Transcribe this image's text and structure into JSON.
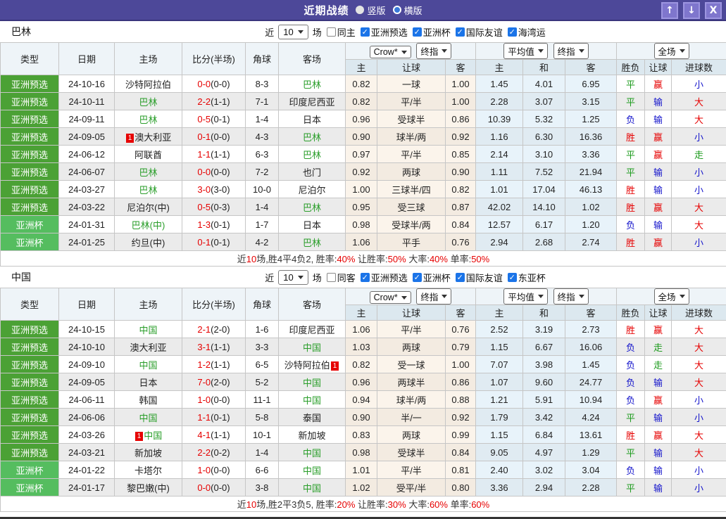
{
  "title_bar": {
    "title": "近期战绩",
    "vertical_label": "竖版",
    "horizontal_label": "横版",
    "up_button": "↑",
    "down_button": "↓",
    "close_button": "X"
  },
  "table_header": {
    "left_cols": [
      "类型",
      "日期",
      "主场",
      "比分(半场)",
      "角球",
      "客场"
    ],
    "dd_company": "Crow*",
    "dd_final1": "终指",
    "dd_average": "平均值",
    "dd_final2": "终指",
    "dd_fulltime": "全场",
    "sub_cols": [
      "主",
      "让球",
      "客",
      "主",
      "和",
      "客",
      "胜负",
      "让球",
      "进球数"
    ]
  },
  "colors": {
    "accent_purple": "#4d4899",
    "type_green_dark": "#4ba135",
    "type_green_light": "#55bd5f",
    "win_red": "#e60000",
    "lose_blue": "#1313cb",
    "draw_green": "#1d9b1d",
    "checkbox_blue": "#1b74e8"
  },
  "sections": [
    {
      "team": "巴林",
      "filter": {
        "near": "近",
        "count": "10",
        "unit": "场",
        "same": "同主",
        "leagues": [
          "亚洲预选",
          "亚洲杯",
          "国际友谊",
          "海湾运"
        ]
      },
      "rows": [
        {
          "type": "亚洲预选",
          "ts": 1,
          "date": "24-10-16",
          "home": {
            "name": "沙特阿拉伯"
          },
          "score": "0-0",
          "half": "(0-0)",
          "corner": "8-3",
          "away": {
            "name": "巴林",
            "green": true
          },
          "crow": [
            "0.82",
            "一球",
            "1.00"
          ],
          "avg": [
            "1.45",
            "4.01",
            "6.95"
          ],
          "res": [
            [
              "平",
              "g"
            ],
            [
              "赢",
              "r"
            ],
            [
              "小",
              "b"
            ]
          ]
        },
        {
          "type": "亚洲预选",
          "ts": 1,
          "date": "24-10-11",
          "home": {
            "name": "巴林",
            "green": true
          },
          "score": "2-2",
          "half": "(1-1)",
          "corner": "7-1",
          "away": {
            "name": "印度尼西亚"
          },
          "crow": [
            "0.82",
            "平/半",
            "1.00"
          ],
          "avg": [
            "2.28",
            "3.07",
            "3.15"
          ],
          "res": [
            [
              "平",
              "g"
            ],
            [
              "输",
              "b"
            ],
            [
              "大",
              "r"
            ]
          ]
        },
        {
          "type": "亚洲预选",
          "ts": 1,
          "date": "24-09-11",
          "home": {
            "name": "巴林",
            "green": true
          },
          "score": "0-5",
          "half": "(0-1)",
          "corner": "1-4",
          "away": {
            "name": "日本"
          },
          "crow": [
            "0.96",
            "受球半",
            "0.86"
          ],
          "avg": [
            "10.39",
            "5.32",
            "1.25"
          ],
          "res": [
            [
              "负",
              "b"
            ],
            [
              "输",
              "b"
            ],
            [
              "大",
              "r"
            ]
          ]
        },
        {
          "type": "亚洲预选",
          "ts": 1,
          "date": "24-09-05",
          "home": {
            "name": "澳大利亚",
            "badge": "1",
            "badge_pos": "before"
          },
          "score": "0-1",
          "half": "(0-0)",
          "corner": "4-3",
          "away": {
            "name": "巴林",
            "green": true
          },
          "crow": [
            "0.90",
            "球半/两",
            "0.92"
          ],
          "avg": [
            "1.16",
            "6.30",
            "16.36"
          ],
          "res": [
            [
              "胜",
              "r"
            ],
            [
              "赢",
              "r"
            ],
            [
              "小",
              "b"
            ]
          ]
        },
        {
          "type": "亚洲预选",
          "ts": 1,
          "date": "24-06-12",
          "home": {
            "name": "阿联酋"
          },
          "score": "1-1",
          "half": "(1-1)",
          "corner": "6-3",
          "away": {
            "name": "巴林",
            "green": true
          },
          "crow": [
            "0.97",
            "平/半",
            "0.85"
          ],
          "avg": [
            "2.14",
            "3.10",
            "3.36"
          ],
          "res": [
            [
              "平",
              "g"
            ],
            [
              "赢",
              "r"
            ],
            [
              "走",
              "g"
            ]
          ]
        },
        {
          "type": "亚洲预选",
          "ts": 1,
          "date": "24-06-07",
          "home": {
            "name": "巴林",
            "green": true
          },
          "score": "0-0",
          "half": "(0-0)",
          "corner": "7-2",
          "away": {
            "name": "也门"
          },
          "crow": [
            "0.92",
            "两球",
            "0.90"
          ],
          "avg": [
            "1.11",
            "7.52",
            "21.94"
          ],
          "res": [
            [
              "平",
              "g"
            ],
            [
              "输",
              "b"
            ],
            [
              "小",
              "b"
            ]
          ]
        },
        {
          "type": "亚洲预选",
          "ts": 1,
          "date": "24-03-27",
          "home": {
            "name": "巴林",
            "green": true
          },
          "score": "3-0",
          "half": "(3-0)",
          "corner": "10-0",
          "away": {
            "name": "尼泊尔"
          },
          "crow": [
            "1.00",
            "三球半/四",
            "0.82"
          ],
          "avg": [
            "1.01",
            "17.04",
            "46.13"
          ],
          "res": [
            [
              "胜",
              "r"
            ],
            [
              "输",
              "b"
            ],
            [
              "小",
              "b"
            ]
          ]
        },
        {
          "type": "亚洲预选",
          "ts": 1,
          "date": "24-03-22",
          "home": {
            "name": "尼泊尔(中)"
          },
          "score": "0-5",
          "half": "(0-3)",
          "corner": "1-4",
          "away": {
            "name": "巴林",
            "green": true
          },
          "crow": [
            "0.95",
            "受三球",
            "0.87"
          ],
          "avg": [
            "42.02",
            "14.10",
            "1.02"
          ],
          "res": [
            [
              "胜",
              "r"
            ],
            [
              "赢",
              "r"
            ],
            [
              "大",
              "r"
            ]
          ]
        },
        {
          "type": "亚洲杯",
          "ts": 2,
          "date": "24-01-31",
          "home": {
            "name": "巴林(中)",
            "green": true
          },
          "score": "1-3",
          "half": "(0-1)",
          "corner": "1-7",
          "away": {
            "name": "日本"
          },
          "crow": [
            "0.98",
            "受球半/两",
            "0.84"
          ],
          "avg": [
            "12.57",
            "6.17",
            "1.20"
          ],
          "res": [
            [
              "负",
              "b"
            ],
            [
              "输",
              "b"
            ],
            [
              "大",
              "r"
            ]
          ]
        },
        {
          "type": "亚洲杯",
          "ts": 2,
          "date": "24-01-25",
          "home": {
            "name": "约旦(中)"
          },
          "score": "0-1",
          "half": "(0-1)",
          "corner": "4-2",
          "away": {
            "name": "巴林",
            "green": true
          },
          "crow": [
            "1.06",
            "平手",
            "0.76"
          ],
          "avg": [
            "2.94",
            "2.68",
            "2.74"
          ],
          "res": [
            [
              "胜",
              "r"
            ],
            [
              "赢",
              "r"
            ],
            [
              "小",
              "b"
            ]
          ]
        }
      ],
      "summary": [
        [
          "近",
          0
        ],
        [
          "10",
          1
        ],
        [
          "场,胜4平4负2, 胜率:",
          0
        ],
        [
          "40%",
          1
        ],
        [
          " 让胜率:",
          0
        ],
        [
          "50%",
          1
        ],
        [
          " 大率:",
          0
        ],
        [
          "40%",
          1
        ],
        [
          " 单率:",
          0
        ],
        [
          "50%",
          1
        ]
      ]
    },
    {
      "team": "中国",
      "filter": {
        "near": "近",
        "count": "10",
        "unit": "场",
        "same": "同客",
        "leagues": [
          "亚洲预选",
          "亚洲杯",
          "国际友谊",
          "东亚杯"
        ]
      },
      "rows": [
        {
          "type": "亚洲预选",
          "ts": 1,
          "date": "24-10-15",
          "home": {
            "name": "中国",
            "green": true
          },
          "score": "2-1",
          "half": "(2-0)",
          "corner": "1-6",
          "away": {
            "name": "印度尼西亚"
          },
          "crow": [
            "1.06",
            "平/半",
            "0.76"
          ],
          "avg": [
            "2.52",
            "3.19",
            "2.73"
          ],
          "res": [
            [
              "胜",
              "r"
            ],
            [
              "赢",
              "r"
            ],
            [
              "大",
              "r"
            ]
          ]
        },
        {
          "type": "亚洲预选",
          "ts": 1,
          "date": "24-10-10",
          "home": {
            "name": "澳大利亚"
          },
          "score": "3-1",
          "half": "(1-1)",
          "corner": "3-3",
          "away": {
            "name": "中国",
            "green": true
          },
          "crow": [
            "1.03",
            "两球",
            "0.79"
          ],
          "avg": [
            "1.15",
            "6.67",
            "16.06"
          ],
          "res": [
            [
              "负",
              "b"
            ],
            [
              "走",
              "g"
            ],
            [
              "大",
              "r"
            ]
          ]
        },
        {
          "type": "亚洲预选",
          "ts": 1,
          "date": "24-09-10",
          "home": {
            "name": "中国",
            "green": true
          },
          "score": "1-2",
          "half": "(1-1)",
          "corner": "6-5",
          "away": {
            "name": "沙特阿拉伯",
            "badge": "1",
            "badge_pos": "after"
          },
          "crow": [
            "0.82",
            "受一球",
            "1.00"
          ],
          "avg": [
            "7.07",
            "3.98",
            "1.45"
          ],
          "res": [
            [
              "负",
              "b"
            ],
            [
              "走",
              "g"
            ],
            [
              "大",
              "r"
            ]
          ]
        },
        {
          "type": "亚洲预选",
          "ts": 1,
          "date": "24-09-05",
          "home": {
            "name": "日本"
          },
          "score": "7-0",
          "half": "(2-0)",
          "corner": "5-2",
          "away": {
            "name": "中国",
            "green": true
          },
          "crow": [
            "0.96",
            "两球半",
            "0.86"
          ],
          "avg": [
            "1.07",
            "9.60",
            "24.77"
          ],
          "res": [
            [
              "负",
              "b"
            ],
            [
              "输",
              "b"
            ],
            [
              "大",
              "r"
            ]
          ]
        },
        {
          "type": "亚洲预选",
          "ts": 1,
          "date": "24-06-11",
          "home": {
            "name": "韩国"
          },
          "score": "1-0",
          "half": "(0-0)",
          "corner": "11-1",
          "away": {
            "name": "中国",
            "green": true
          },
          "crow": [
            "0.94",
            "球半/两",
            "0.88"
          ],
          "avg": [
            "1.21",
            "5.91",
            "10.94"
          ],
          "res": [
            [
              "负",
              "b"
            ],
            [
              "赢",
              "r"
            ],
            [
              "小",
              "b"
            ]
          ]
        },
        {
          "type": "亚洲预选",
          "ts": 1,
          "date": "24-06-06",
          "home": {
            "name": "中国",
            "green": true
          },
          "score": "1-1",
          "half": "(0-1)",
          "corner": "5-8",
          "away": {
            "name": "泰国"
          },
          "crow": [
            "0.90",
            "半/一",
            "0.92"
          ],
          "avg": [
            "1.79",
            "3.42",
            "4.24"
          ],
          "res": [
            [
              "平",
              "g"
            ],
            [
              "输",
              "b"
            ],
            [
              "小",
              "b"
            ]
          ]
        },
        {
          "type": "亚洲预选",
          "ts": 1,
          "date": "24-03-26",
          "home": {
            "name": "中国",
            "green": true,
            "badge": "1",
            "badge_pos": "before"
          },
          "score": "4-1",
          "half": "(1-1)",
          "corner": "10-1",
          "away": {
            "name": "新加坡"
          },
          "crow": [
            "0.83",
            "两球",
            "0.99"
          ],
          "avg": [
            "1.15",
            "6.84",
            "13.61"
          ],
          "res": [
            [
              "胜",
              "r"
            ],
            [
              "赢",
              "r"
            ],
            [
              "大",
              "r"
            ]
          ]
        },
        {
          "type": "亚洲预选",
          "ts": 1,
          "date": "24-03-21",
          "home": {
            "name": "新加坡"
          },
          "score": "2-2",
          "half": "(0-2)",
          "corner": "1-4",
          "away": {
            "name": "中国",
            "green": true
          },
          "crow": [
            "0.98",
            "受球半",
            "0.84"
          ],
          "avg": [
            "9.05",
            "4.97",
            "1.29"
          ],
          "res": [
            [
              "平",
              "g"
            ],
            [
              "输",
              "b"
            ],
            [
              "大",
              "r"
            ]
          ]
        },
        {
          "type": "亚洲杯",
          "ts": 2,
          "date": "24-01-22",
          "home": {
            "name": "卡塔尔"
          },
          "score": "1-0",
          "half": "(0-0)",
          "corner": "6-6",
          "away": {
            "name": "中国",
            "green": true
          },
          "crow": [
            "1.01",
            "平/半",
            "0.81"
          ],
          "avg": [
            "2.40",
            "3.02",
            "3.04"
          ],
          "res": [
            [
              "负",
              "b"
            ],
            [
              "输",
              "b"
            ],
            [
              "小",
              "b"
            ]
          ]
        },
        {
          "type": "亚洲杯",
          "ts": 2,
          "date": "24-01-17",
          "home": {
            "name": "黎巴嫩(中)"
          },
          "score": "0-0",
          "half": "(0-0)",
          "corner": "3-8",
          "away": {
            "name": "中国",
            "green": true
          },
          "crow": [
            "1.02",
            "受平/半",
            "0.80"
          ],
          "avg": [
            "3.36",
            "2.94",
            "2.28"
          ],
          "res": [
            [
              "平",
              "g"
            ],
            [
              "输",
              "b"
            ],
            [
              "小",
              "b"
            ]
          ]
        }
      ],
      "summary": [
        [
          "近",
          0
        ],
        [
          "10",
          1
        ],
        [
          "场,胜2平3负5, 胜率:",
          0
        ],
        [
          "20%",
          1
        ],
        [
          " 让胜率:",
          0
        ],
        [
          "30%",
          1
        ],
        [
          " 大率:",
          0
        ],
        [
          "60%",
          1
        ],
        [
          " 单率:",
          0
        ],
        [
          "60%",
          1
        ]
      ]
    }
  ]
}
